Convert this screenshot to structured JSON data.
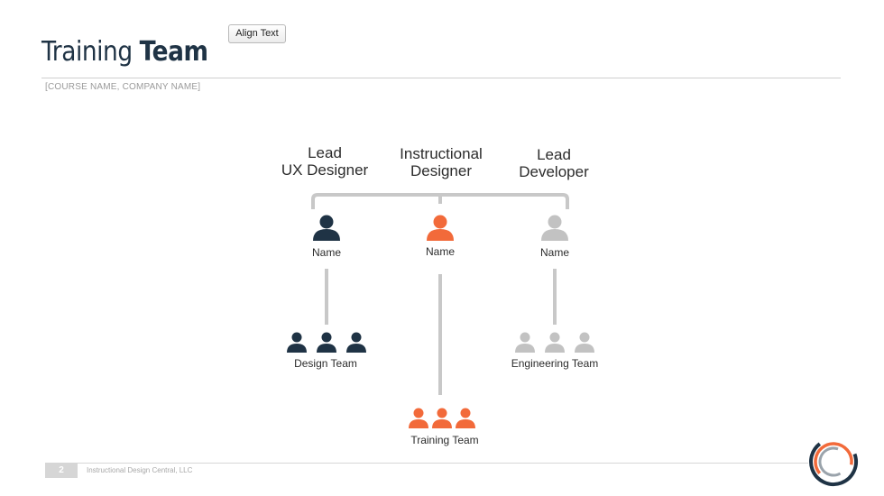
{
  "slide": {
    "title_regular": "Training",
    "title_bold": "Team",
    "subtitle": "[COURSE NAME, COMPANY NAME]",
    "align_button": "Align Text"
  },
  "org": {
    "roles": [
      {
        "line1": "Lead",
        "line2": "UX Designer",
        "name": "Name",
        "color": "#1f3345"
      },
      {
        "line1": "Instructional",
        "line2": "Designer",
        "name": "Name",
        "color": "#f26a3a"
      },
      {
        "line1": "Lead",
        "line2": "Developer",
        "name": "Name",
        "color": "#c2c2c2"
      }
    ],
    "teams": [
      {
        "label": "Design Team",
        "color": "#1f3345"
      },
      {
        "label": "Training Team",
        "color": "#f26a3a"
      },
      {
        "label": "Engineering Team",
        "color": "#c2c2c2"
      }
    ]
  },
  "footer": {
    "page_number": "2",
    "company": "Instructional Design Central, LLC"
  }
}
